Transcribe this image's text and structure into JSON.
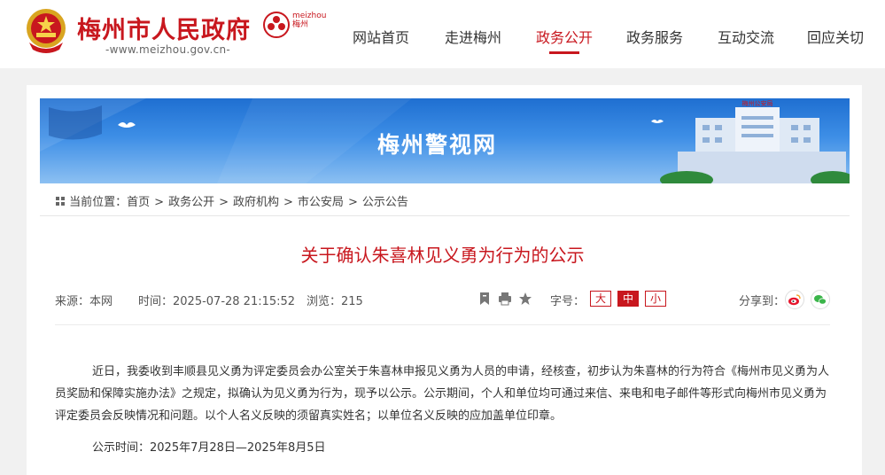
{
  "header": {
    "site_title": "梅州市人民政府",
    "site_url": "-www.meizhou.gov.cn-",
    "city_logo_text_line1": "meizhou",
    "city_logo_text_line2": "梅州",
    "nav": [
      {
        "label": "网站首页",
        "active": false
      },
      {
        "label": "走进梅州",
        "active": false
      },
      {
        "label": "政务公开",
        "active": true
      },
      {
        "label": "政务服务",
        "active": false
      },
      {
        "label": "互动交流",
        "active": false
      },
      {
        "label": "回应关切",
        "active": false
      }
    ]
  },
  "banner": {
    "title": "梅州警视网",
    "building_sign": "梅州公安局"
  },
  "breadcrumb": {
    "prefix": "当前位置：",
    "items": [
      "首页",
      "政务公开",
      "政府机构",
      "市公安局",
      "公示公告"
    ]
  },
  "article": {
    "title": "关于确认朱喜林见义勇为行为的公示",
    "source": "来源：本网",
    "time": "时间：2025-07-28 21:15:52",
    "views": "浏览：215",
    "font_size_label": "字号：",
    "font_sizes": [
      "大",
      "中",
      "小"
    ],
    "font_size_active": "中",
    "share_label": "分享到：",
    "body": "近日，我委收到丰顺县见义勇为评定委员会办公室关于朱喜林申报见义勇为人员的申请，经核查，初步认为朱喜林的行为符合《梅州市见义勇为人员奖励和保障实施办法》之规定，拟确认为见义勇为行为，现予以公示。公示期间，个人和单位均可通过来信、来电和电子邮件等形式向梅州市见义勇为评定委员会反映情况和问题。以个人名义反映的须留真实姓名；以单位名义反映的应加盖单位印章。",
    "period": "公示时间：2025年7月28日—2025年8月5日"
  },
  "colors": {
    "brand_red": "#c8171e",
    "banner_blue": "#2f7fdb",
    "page_bg": "#f1f1f1"
  },
  "icons": [
    "national-emblem-icon",
    "meizhou-logo-icon",
    "home-icon",
    "bookmark-icon",
    "print-icon",
    "star-icon",
    "weibo-icon",
    "wechat-icon"
  ]
}
